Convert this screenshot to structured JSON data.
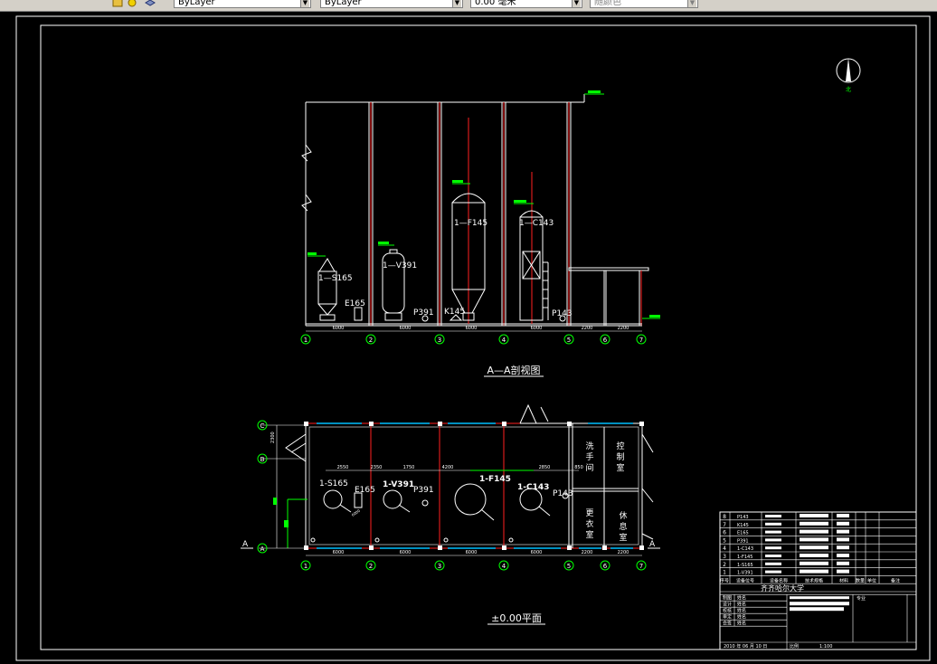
{
  "toolbar": {
    "layer_box": "ByLayer",
    "linetype_box": "ByLayer",
    "lineweight_box": "0.00 毫米",
    "plotstyle_box": "随颜色"
  },
  "drawing": {
    "north_label": "北",
    "section": {
      "title": "A—A剖视图",
      "equipment": [
        "1—S165",
        "1—V391",
        "1—F145",
        "1—C143"
      ],
      "labels": [
        "E165",
        "P391",
        "K145",
        "P143"
      ],
      "axes": [
        "1",
        "2",
        "3",
        "4",
        "5",
        "6",
        "7"
      ],
      "dims": [
        "6000",
        "6000",
        "6000",
        "6000",
        "2200",
        "2200"
      ]
    },
    "plan": {
      "title": "±0.00平面",
      "equipment": [
        "1-S165",
        "1-V391",
        "1-F145",
        "1-C143"
      ],
      "labels": [
        "E165",
        "P391",
        "P143"
      ],
      "rooms": [
        "洗手间",
        "控制室",
        "更衣室",
        "休息室"
      ],
      "axes": [
        "1",
        "2",
        "3",
        "4",
        "5",
        "6",
        "7"
      ],
      "row_axes": [
        "C",
        "B",
        "A"
      ],
      "cut_marks": [
        "A",
        "A"
      ],
      "dims_bottom": [
        "6000",
        "6000",
        "6000",
        "6000",
        "2200",
        "2200"
      ],
      "dims_top": [
        "2550",
        "2350",
        "1750",
        "4200",
        "2850",
        "850"
      ],
      "dims_left": [
        "2300",
        "3800"
      ]
    },
    "title_block": {
      "school": "齐齐哈尔大学",
      "rows": [
        "8",
        "7",
        "6",
        "5",
        "4",
        "3",
        "2",
        "1"
      ],
      "part_labels": [
        "P143",
        "K145",
        "E165",
        "P391",
        "1-C143",
        "1-F145",
        "1-S165",
        "1-V391"
      ],
      "header": [
        "序号",
        "设备位号",
        "设备名称",
        "技术规格",
        "材料",
        "数量",
        "单位",
        "备注"
      ],
      "signers": [
        "制图",
        "设计",
        "校核",
        "审定",
        "会签"
      ],
      "signer_names": [
        "姓名",
        "姓名",
        "姓名",
        "姓名",
        "姓名"
      ],
      "major_label": "专业",
      "date": "2010 年 06 月 10 日",
      "scale_label": "比例",
      "scale": "1:100"
    }
  }
}
